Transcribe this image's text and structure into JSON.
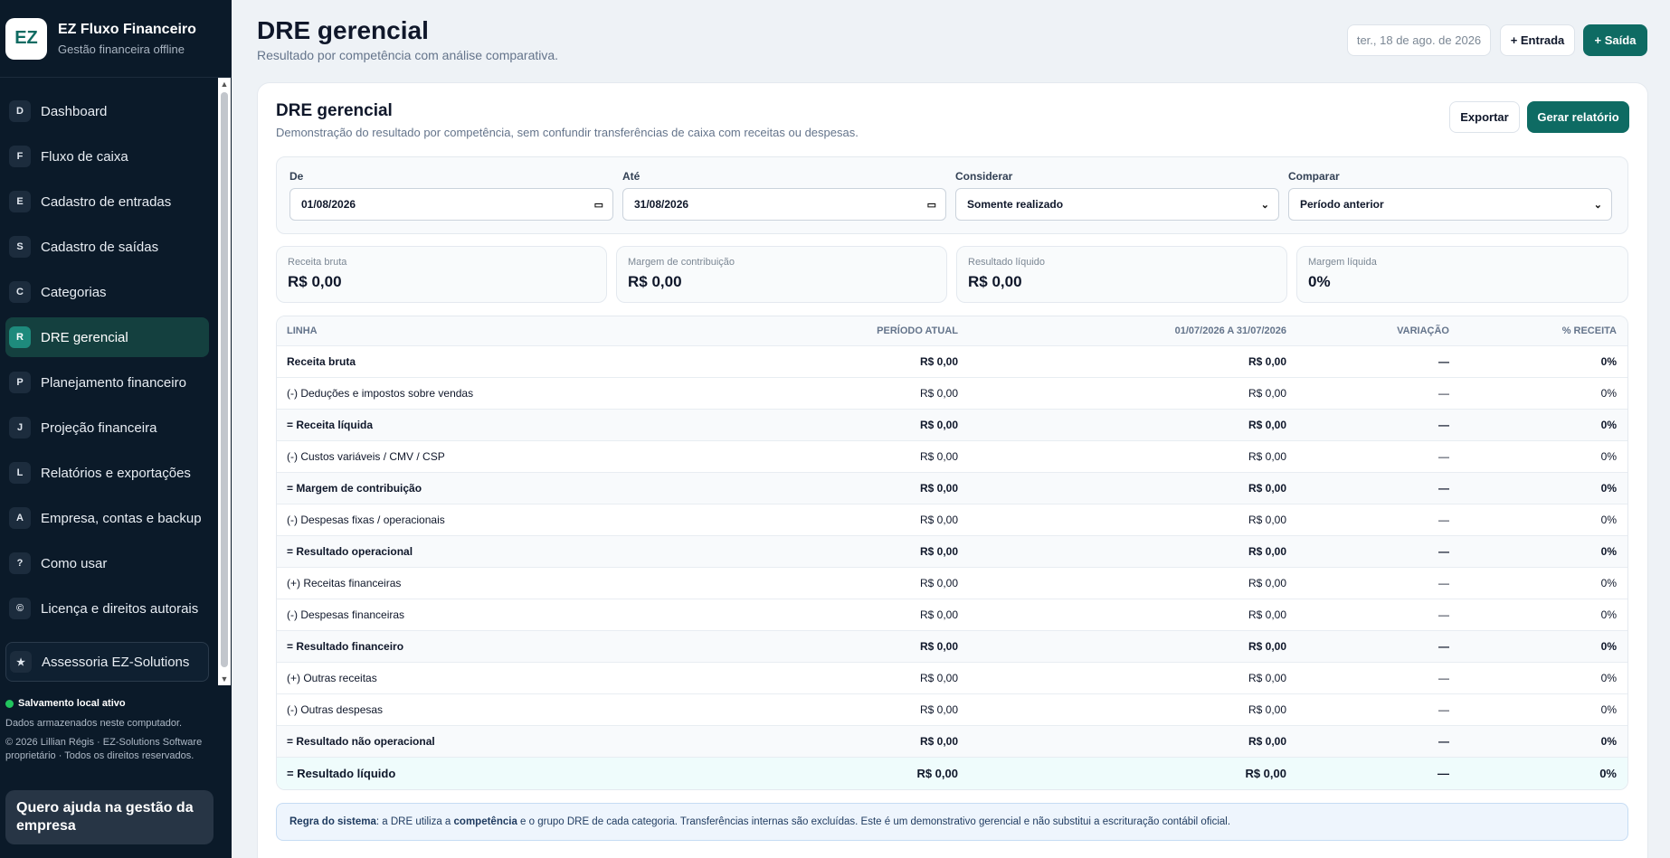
{
  "brand": {
    "logo": "EZ",
    "name": "EZ Fluxo Financeiro",
    "subtitle": "Gestão financeira offline"
  },
  "sidebar": {
    "items": [
      {
        "badge": "D",
        "label": "Dashboard"
      },
      {
        "badge": "F",
        "label": "Fluxo de caixa"
      },
      {
        "badge": "E",
        "label": "Cadastro de entradas"
      },
      {
        "badge": "S",
        "label": "Cadastro de saídas"
      },
      {
        "badge": "C",
        "label": "Categorias"
      },
      {
        "badge": "R",
        "label": "DRE gerencial",
        "active": true
      },
      {
        "badge": "P",
        "label": "Planejamento financeiro"
      },
      {
        "badge": "J",
        "label": "Projeção financeira"
      },
      {
        "badge": "L",
        "label": "Relatórios e exportações"
      },
      {
        "badge": "A",
        "label": "Empresa, contas e backup"
      },
      {
        "badge": "?",
        "label": "Como usar"
      },
      {
        "badge": "©",
        "label": "Licença e direitos autorais"
      },
      {
        "badge": "★",
        "label": "Assessoria EZ-Solutions"
      }
    ],
    "save_status": "Salvamento local ativo",
    "save_note": "Dados armazenados neste computador.",
    "copyright": "© 2026 Lillian Régis · EZ-Solutions Software proprietário · Todos os direitos reservados.",
    "help_card": "Quero ajuda na gestão da empresa"
  },
  "header": {
    "title": "DRE gerencial",
    "subtitle": "Resultado por competência com análise comparativa.",
    "date": "ter., 18 de ago. de 2026",
    "entrada_label": "+ Entrada",
    "saida_label": "+ Saída"
  },
  "card": {
    "title": "DRE gerencial",
    "subtitle": "Demonstração do resultado por competência, sem confundir transferências de caixa com receitas ou despesas.",
    "export_label": "Exportar",
    "report_label": "Gerar relatório"
  },
  "filters": {
    "from_label": "De",
    "from_value": "01/08/2026",
    "to_label": "Até",
    "to_value": "31/08/2026",
    "consider_label": "Considerar",
    "consider_value": "Somente realizado",
    "compare_label": "Comparar",
    "compare_value": "Período anterior"
  },
  "kpis": [
    {
      "label": "Receita bruta",
      "value": "R$ 0,00"
    },
    {
      "label": "Margem de contribuição",
      "value": "R$ 0,00"
    },
    {
      "label": "Resultado líquido",
      "value": "R$ 0,00"
    },
    {
      "label": "Margem líquida",
      "value": "0%"
    }
  ],
  "table": {
    "headers": [
      "LINHA",
      "PERÍODO ATUAL",
      "01/07/2026 A 31/07/2026",
      "VARIAÇÃO",
      "% RECEITA"
    ],
    "rows": [
      [
        "Receita bruta",
        "R$ 0,00",
        "R$ 0,00",
        "—",
        "0%"
      ],
      [
        "(-) Deduções e impostos sobre vendas",
        "R$ 0,00",
        "R$ 0,00",
        "—",
        "0%"
      ],
      [
        "= Receita líquida",
        "R$ 0,00",
        "R$ 0,00",
        "—",
        "0%"
      ],
      [
        "(-) Custos variáveis / CMV / CSP",
        "R$ 0,00",
        "R$ 0,00",
        "—",
        "0%"
      ],
      [
        "= Margem de contribuição",
        "R$ 0,00",
        "R$ 0,00",
        "—",
        "0%"
      ],
      [
        "(-) Despesas fixas / operacionais",
        "R$ 0,00",
        "R$ 0,00",
        "—",
        "0%"
      ],
      [
        "= Resultado operacional",
        "R$ 0,00",
        "R$ 0,00",
        "—",
        "0%"
      ],
      [
        "(+) Receitas financeiras",
        "R$ 0,00",
        "R$ 0,00",
        "—",
        "0%"
      ],
      [
        "(-) Despesas financeiras",
        "R$ 0,00",
        "R$ 0,00",
        "—",
        "0%"
      ],
      [
        "= Resultado financeiro",
        "R$ 0,00",
        "R$ 0,00",
        "—",
        "0%"
      ],
      [
        "(+) Outras receitas",
        "R$ 0,00",
        "R$ 0,00",
        "—",
        "0%"
      ],
      [
        "(-) Outras despesas",
        "R$ 0,00",
        "R$ 0,00",
        "—",
        "0%"
      ],
      [
        "= Resultado não operacional",
        "R$ 0,00",
        "R$ 0,00",
        "—",
        "0%"
      ],
      [
        "= Resultado líquido",
        "R$ 0,00",
        "R$ 0,00",
        "—",
        "0%"
      ]
    ]
  },
  "rule": {
    "lead": "Regra do sistema",
    "part1": ": a DRE utiliza a ",
    "keyword": "competência",
    "part2": " e o grupo DRE de cada categoria. Transferências internas são excluídas. Este é um demonstrativo gerencial e não substitui a escrituração contábil oficial."
  }
}
